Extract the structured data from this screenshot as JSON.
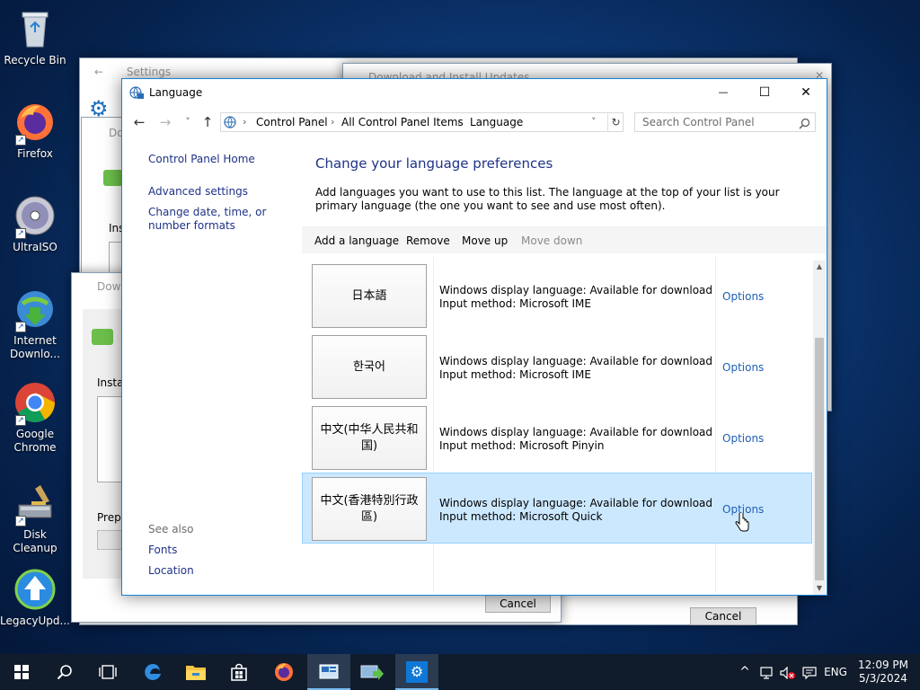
{
  "desktop": {
    "icons": [
      {
        "label": "Recycle Bin",
        "icon": "recycle-bin-icon"
      },
      {
        "label": "Firefox",
        "icon": "firefox-icon"
      },
      {
        "label": "UltraISO",
        "icon": "ultraiso-icon"
      },
      {
        "label": "Internet Downlo...",
        "icon": "internet-download-manager-icon"
      },
      {
        "label": "Google Chrome",
        "icon": "chrome-icon"
      },
      {
        "label": "Disk Cleanup",
        "icon": "disk-cleanup-icon"
      },
      {
        "label": "LegacyUpd...",
        "icon": "legacy-update-icon"
      }
    ]
  },
  "background_windows": {
    "settings_title": "Settings",
    "download_title": "Download and Install Updates",
    "dow_title_short": "Dow",
    "do_title_short": "Do",
    "insta_label": "Insta",
    "ins_label": "Ins",
    "prepa_label": "Prepa",
    "cancel_label": "Cancel",
    "cancel_label_2": "Cancel"
  },
  "window": {
    "title": "Language",
    "minimize_glyph": "—",
    "maximize_glyph": "☐",
    "close_glyph": "✕"
  },
  "nav": {
    "back_glyph": "←",
    "forward_glyph": "→",
    "recent_glyph": "˅",
    "up_glyph": "↑",
    "breadcrumbs": [
      "Control Panel",
      "All Control Panel Items",
      "Language"
    ],
    "separator": "›",
    "dropdown_glyph": "˅",
    "refresh_glyph": "↻",
    "search_placeholder": "Search Control Panel"
  },
  "sidebar": {
    "home": "Control Panel Home",
    "advanced": "Advanced settings",
    "datetime": "Change date, time, or number formats",
    "see_also": "See also",
    "fonts": "Fonts",
    "location": "Location"
  },
  "content": {
    "heading": "Change your language preferences",
    "description": "Add languages you want to use to this list. The language at the top of your list is your primary language (the one you want to see and use most often).",
    "toolbar": {
      "add": "Add a language",
      "remove": "Remove",
      "move_up": "Move up",
      "move_down": "Move down"
    },
    "languages": [
      {
        "name": "日本語",
        "display": "Windows display language: Available for download",
        "input": "Input method: Microsoft IME",
        "options": "Options",
        "selected": false
      },
      {
        "name": "한국어",
        "display": "Windows display language: Available for download",
        "input": "Input method: Microsoft IME",
        "options": "Options",
        "selected": false
      },
      {
        "name": "中文(中华人民共和国)",
        "display": "Windows display language: Available for download",
        "input": "Input method: Microsoft Pinyin",
        "options": "Options",
        "selected": false
      },
      {
        "name": "中文(香港特別行政區)",
        "display": "Windows display language: Available for download",
        "input": "Input method: Microsoft Quick",
        "options": "Options",
        "selected": true
      }
    ]
  },
  "taskbar": {
    "apps": [
      "start-icon",
      "search-icon",
      "task-view-icon",
      "edge-icon",
      "file-explorer-icon",
      "store-icon",
      "firefox-icon",
      "language-panel-icon",
      "windows-update-icon",
      "settings-icon"
    ],
    "tray_chevron": "^",
    "language_indicator": "ENG",
    "time": "12:09 PM",
    "date": "5/3/2024"
  },
  "colors": {
    "accent": "#1883d7",
    "link": "#1e3287",
    "selection": "#cce8ff",
    "taskbar": "#101b2b"
  }
}
